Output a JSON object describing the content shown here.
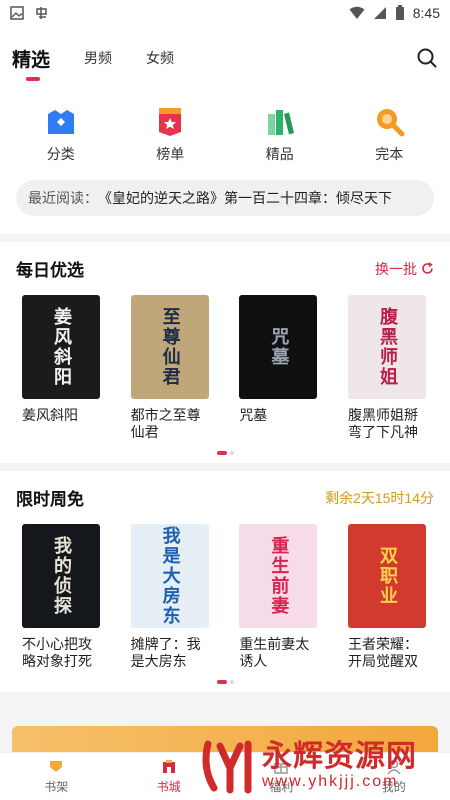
{
  "status": {
    "time": "8:45"
  },
  "nav": {
    "tabs": [
      "精选",
      "男频",
      "女频"
    ],
    "active": 0
  },
  "quick": {
    "items": [
      {
        "label": "分类",
        "icon": "category-icon",
        "color": "#2f7df6"
      },
      {
        "label": "榜单",
        "icon": "ranking-icon",
        "color": "#e8344a"
      },
      {
        "label": "精品",
        "icon": "books-icon",
        "color": "#2db36b"
      },
      {
        "label": "完本",
        "icon": "finished-icon",
        "color": "#f59a23"
      }
    ],
    "recent_label": "最近阅读：",
    "recent_title": "《皇妃的逆天之路》第一百二十四章：倾尽天下"
  },
  "daily": {
    "title": "每日优选",
    "action": "换一批",
    "books": [
      {
        "title": "姜风斜阳",
        "cover_text": "姜风斜阳",
        "bg": "#1b1b1b",
        "fg": "#f2f2f2"
      },
      {
        "title": "都市之至尊仙君",
        "cover_text": "至尊仙君",
        "bg": "#bfa77a",
        "fg": "#1d2b48"
      },
      {
        "title": "咒墓",
        "cover_text": "咒墓",
        "bg": "#0f1012",
        "fg": "#9aa4b0"
      },
      {
        "title": "腹黑师姐掰弯了下凡神女",
        "cover_text": "腹黑师姐",
        "bg": "#efe6ea",
        "fg": "#b8214a"
      }
    ]
  },
  "free": {
    "title": "限时周免",
    "countdown": "剩余2天15时14分",
    "books": [
      {
        "title": "不小心把攻略对象打死之…",
        "cover_text": "我的侦探",
        "bg": "#14181d",
        "fg": "#e9e3d6"
      },
      {
        "title": "摊牌了：我是大房东",
        "cover_text": "我是大房东",
        "bg": "#e6eef6",
        "fg": "#1f5fb0"
      },
      {
        "title": "重生前妻太诱人",
        "cover_text": "重生前妻",
        "bg": "#f6dbe8",
        "fg": "#d8244f"
      },
      {
        "title": "王者荣耀：开局觉醒双职业",
        "cover_text": "双职业",
        "bg": "#d23a2e",
        "fg": "#ffd24a"
      }
    ]
  },
  "bottom_nav": {
    "items": [
      {
        "label": "书架",
        "icon": "bookshelf-icon"
      },
      {
        "label": "书城",
        "icon": "bookstore-icon"
      },
      {
        "label": "福利",
        "icon": "welfare-icon"
      },
      {
        "label": "我的",
        "icon": "profile-icon"
      }
    ],
    "active": 1
  },
  "watermark": {
    "main": "永辉资源网",
    "url": "www.yhkjjj.com"
  }
}
